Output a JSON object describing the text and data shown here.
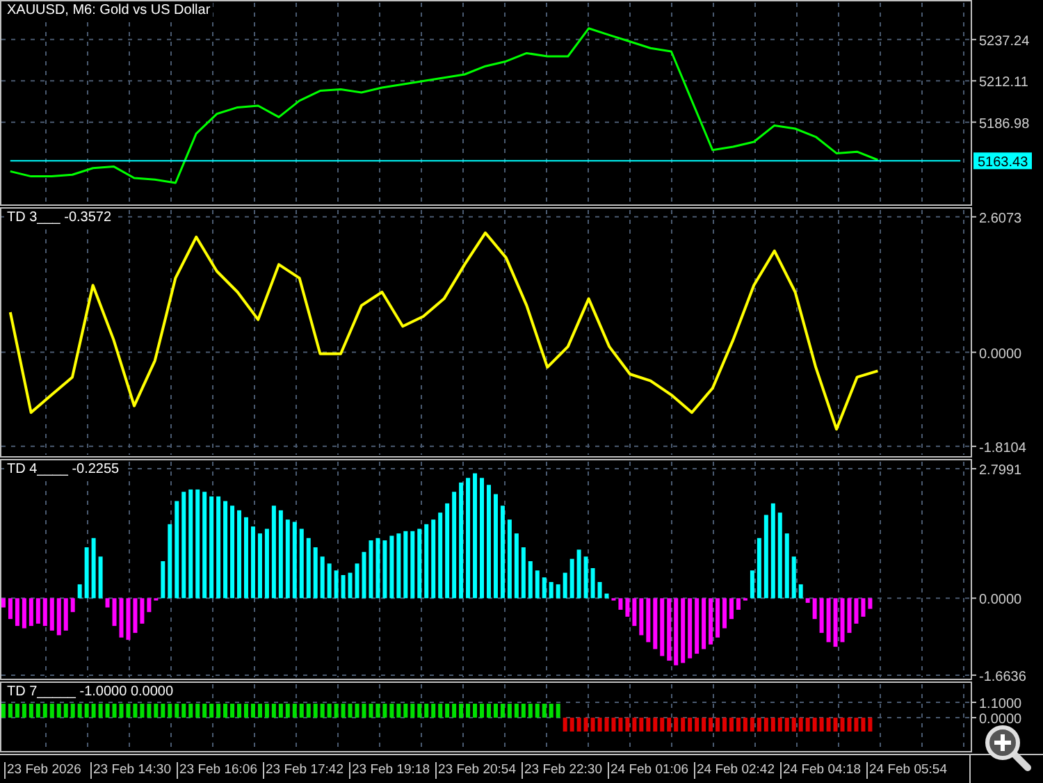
{
  "panes": [
    {
      "kind": "price",
      "title": "XAUUSD, M6:  Gold vs US Dollar",
      "chart_data": {
        "type": "line",
        "grid": true,
        "ylim": [
          5136.89,
          5260.46
        ],
        "yticks": [
          {
            "value": 5163.43,
            "label": "5163.43"
          },
          {
            "value": 5186.98,
            "label": "5186.98"
          },
          {
            "value": 5212.11,
            "label": "5212.11"
          },
          {
            "value": 5237.24,
            "label": "5237.24"
          }
        ],
        "series": [
          {
            "color": "#00ff00",
            "values": [
              5157,
              5154,
              5154,
              5155,
              5159,
              5160,
              5153,
              5152,
              5150,
              5180,
              5192,
              5196,
              5197,
              5190,
              5200,
              5206,
              5207,
              5205,
              5208,
              5210,
              5212,
              5214,
              5216,
              5221,
              5224,
              5229,
              5227,
              5227,
              5244,
              5240,
              5236,
              5232,
              5230,
              5200,
              5170,
              5172,
              5175,
              5185,
              5183,
              5178,
              5168,
              5169,
              5164,
              null,
              null,
              null,
              null
            ]
          },
          {
            "color": "#00ffff",
            "values": [
              5163.43,
              5163.43,
              5163.43,
              5163.43,
              5163.43,
              5163.43,
              5163.43,
              5163.43,
              5163.43,
              5163.43,
              5163.43,
              5163.43,
              5163.43,
              5163.43,
              5163.43,
              5163.43,
              5163.43,
              5163.43,
              5163.43,
              5163.43,
              5163.43,
              5163.43,
              5163.43,
              5163.43,
              5163.43,
              5163.43,
              5163.43,
              5163.43,
              5163.43,
              5163.43,
              5163.43,
              5163.43,
              5163.43,
              5163.43,
              5163.43,
              5163.43,
              5163.43,
              5163.43,
              5163.43,
              5163.43,
              5163.43,
              5163.43,
              5163.43,
              5163.43,
              5163.43,
              5163.43,
              5163.43
            ]
          }
        ]
      }
    },
    {
      "kind": "line",
      "title": "TD 3___ -0.3572",
      "chart_data": {
        "type": "line",
        "grid": true,
        "ylim": [
          -2.0,
          2.765
        ],
        "yticks": [
          {
            "value": -1.8104,
            "label": "-1.8104"
          },
          {
            "value": 0,
            "label": "0.0000"
          },
          {
            "value": 2.6073,
            "label": "2.6073"
          }
        ],
        "series": [
          {
            "color": "#ffff00",
            "values": [
              0.77,
              -1.16,
              -0.82,
              -0.48,
              1.29,
              0.24,
              -1.03,
              -0.16,
              1.43,
              2.22,
              1.56,
              1.16,
              0.63,
              1.69,
              1.43,
              -0.03,
              -0.03,
              0.9,
              1.16,
              0.5,
              0.69,
              1.03,
              1.69,
              2.3,
              1.82,
              0.9,
              -0.29,
              0.11,
              1.03,
              0.11,
              -0.42,
              -0.55,
              -0.82,
              -1.16,
              -0.69,
              0.24,
              1.29,
              1.95,
              1.16,
              -0.29,
              -1.48,
              -0.48,
              -0.36,
              null,
              null,
              null,
              null
            ]
          }
        ]
      }
    },
    {
      "kind": "histogram",
      "title": "TD 4____ -0.2255",
      "chart_data": {
        "type": "bar",
        "stacked": true,
        "grid": true,
        "ylim": [
          -1.74,
          2.98
        ],
        "yticks": [
          {
            "value": -1.6636,
            "label": "-1.6636"
          },
          {
            "value": 0,
            "label": "0.0000"
          },
          {
            "value": 2.7991,
            "label": "2.7991"
          }
        ],
        "series": [
          {
            "color": "#00ffff",
            "values": [
              null,
              null,
              null,
              null,
              null,
              null,
              null,
              null,
              null,
              null,
              null,
              0.3,
              1.1,
              1.3,
              0.9,
              null,
              null,
              null,
              null,
              null,
              null,
              null,
              null,
              0.8,
              1.6,
              2.1,
              2.3,
              2.35,
              2.35,
              2.3,
              2.2,
              2.2,
              2.1,
              2.0,
              1.9,
              1.75,
              1.55,
              1.4,
              1.5,
              2.0,
              1.9,
              1.7,
              1.65,
              1.5,
              1.3,
              1.1,
              0.9,
              0.75,
              0.6,
              0.5,
              0.55,
              0.75,
              1.0,
              1.25,
              1.3,
              1.25,
              1.35,
              1.4,
              1.45,
              1.45,
              1.5,
              1.6,
              1.7,
              1.85,
              2.05,
              2.3,
              2.5,
              2.6,
              2.7,
              2.6,
              2.45,
              2.25,
              2.0,
              1.7,
              1.4,
              1.1,
              0.8,
              0.6,
              0.45,
              0.35,
              0.3,
              0.55,
              0.85,
              1.05,
              0.9,
              0.65,
              0.35,
              0.1,
              null,
              null,
              null,
              null,
              null,
              null,
              null,
              null,
              null,
              null,
              null,
              null,
              null,
              null,
              null,
              null,
              null,
              null,
              null,
              null,
              0.6,
              1.3,
              1.8,
              2.05,
              1.85,
              1.4,
              0.9,
              0.3,
              null,
              null,
              null,
              null,
              null,
              null,
              null,
              null,
              null,
              null,
              null,
              null,
              null,
              null,
              null,
              null,
              null,
              null,
              null,
              null,
              null,
              null,
              null,
              null
            ]
          },
          {
            "color": "#ff00ff",
            "values": [
              -0.2,
              -0.45,
              -0.6,
              -0.65,
              -0.6,
              -0.55,
              -0.6,
              -0.7,
              -0.8,
              -0.7,
              -0.3,
              null,
              null,
              null,
              null,
              -0.2,
              -0.6,
              -0.85,
              -0.9,
              -0.75,
              -0.55,
              -0.3,
              -0.05,
              null,
              null,
              null,
              null,
              null,
              null,
              null,
              null,
              null,
              null,
              null,
              null,
              null,
              null,
              null,
              null,
              null,
              null,
              null,
              null,
              null,
              null,
              null,
              null,
              null,
              null,
              null,
              null,
              null,
              null,
              null,
              null,
              null,
              null,
              null,
              null,
              null,
              null,
              null,
              null,
              null,
              null,
              null,
              null,
              null,
              null,
              null,
              null,
              null,
              null,
              null,
              null,
              null,
              null,
              null,
              null,
              null,
              null,
              null,
              null,
              null,
              null,
              null,
              null,
              null,
              -0.05,
              -0.25,
              -0.4,
              -0.6,
              -0.8,
              -0.95,
              -1.1,
              -1.25,
              -1.35,
              -1.45,
              -1.4,
              -1.3,
              -1.2,
              -1.1,
              -1.0,
              -0.85,
              -0.65,
              -0.45,
              -0.25,
              -0.05,
              null,
              null,
              null,
              null,
              null,
              null,
              null,
              null,
              -0.1,
              -0.45,
              -0.75,
              -0.95,
              -1.05,
              -0.95,
              -0.75,
              -0.55,
              -0.4,
              -0.23,
              null,
              null,
              null,
              null,
              null,
              null,
              null,
              null,
              null,
              null,
              null,
              null,
              null,
              null
            ]
          }
        ]
      }
    },
    {
      "kind": "histogram",
      "title": "TD 7_____ -1.0000 0.0000",
      "chart_data": {
        "type": "bar",
        "stacked": true,
        "grid": true,
        "ylim": [
          -2.4,
          2.5
        ],
        "yticks": [
          {
            "value": 0,
            "label": "0.0000"
          },
          {
            "value": 1.1,
            "label": "1.1000"
          }
        ],
        "series": [
          {
            "color": "#00e000",
            "values": [
              1,
              1,
              1,
              1,
              1,
              1,
              1,
              1,
              1,
              1,
              1,
              1,
              1,
              1,
              1,
              1,
              1,
              1,
              1,
              1,
              1,
              1,
              1,
              1,
              1,
              1,
              1,
              1,
              1,
              1,
              1,
              1,
              1,
              1,
              1,
              1,
              1,
              1,
              1,
              1,
              1,
              1,
              1,
              1,
              1,
              1,
              1,
              1,
              1,
              1,
              1,
              1,
              1,
              1,
              1,
              1,
              1,
              1,
              1,
              1,
              1,
              1,
              1,
              1,
              1,
              1,
              1,
              1,
              1,
              1,
              1,
              1,
              1,
              1,
              1,
              1,
              1,
              1,
              1,
              1,
              1,
              null,
              null,
              null,
              null,
              null,
              null,
              null,
              null,
              null,
              null,
              null,
              null,
              null,
              null,
              null,
              null,
              null,
              null,
              null,
              null,
              null,
              null,
              null,
              null,
              null,
              null,
              null,
              null,
              null,
              null,
              null,
              null,
              null,
              null,
              null,
              null,
              null,
              null,
              null,
              null,
              null,
              null,
              null,
              null,
              null,
              null,
              null,
              null,
              null,
              null,
              null,
              null,
              null,
              null,
              null,
              null,
              null,
              null,
              null
            ]
          },
          {
            "color": "#e00000",
            "values": [
              null,
              null,
              null,
              null,
              null,
              null,
              null,
              null,
              null,
              null,
              null,
              null,
              null,
              null,
              null,
              null,
              null,
              null,
              null,
              null,
              null,
              null,
              null,
              null,
              null,
              null,
              null,
              null,
              null,
              null,
              null,
              null,
              null,
              null,
              null,
              null,
              null,
              null,
              null,
              null,
              null,
              null,
              null,
              null,
              null,
              null,
              null,
              null,
              null,
              null,
              null,
              null,
              null,
              null,
              null,
              null,
              null,
              null,
              null,
              null,
              null,
              null,
              null,
              null,
              null,
              null,
              null,
              null,
              null,
              null,
              null,
              null,
              null,
              null,
              null,
              null,
              null,
              null,
              null,
              null,
              null,
              -1,
              -1,
              -1,
              -1,
              -1,
              -1,
              -1,
              -1,
              -1,
              -1,
              -1,
              -1,
              -1,
              -1,
              -1,
              -1,
              -1,
              -1,
              -1,
              -1,
              -1,
              -1,
              -1,
              -1,
              -1,
              -1,
              -1,
              -1,
              -1,
              -1,
              -1,
              -1,
              -1,
              -1,
              -1,
              -1,
              -1,
              -1,
              -1,
              -1,
              -1,
              -1,
              -1,
              -1,
              -1,
              null,
              null,
              null,
              null,
              null,
              null,
              null,
              null,
              null,
              null,
              null,
              null,
              null,
              null
            ]
          }
        ]
      }
    }
  ],
  "time_axis": {
    "labels": [
      "23 Feb 2026",
      "23 Feb 14:30",
      "23 Feb 16:06",
      "23 Feb 17:42",
      "23 Feb 19:18",
      "23 Feb 20:54",
      "23 Feb 22:30",
      "24 Feb 01:06",
      "24 Feb 02:42",
      "24 Feb 04:18",
      "24 Feb 05:54"
    ]
  }
}
